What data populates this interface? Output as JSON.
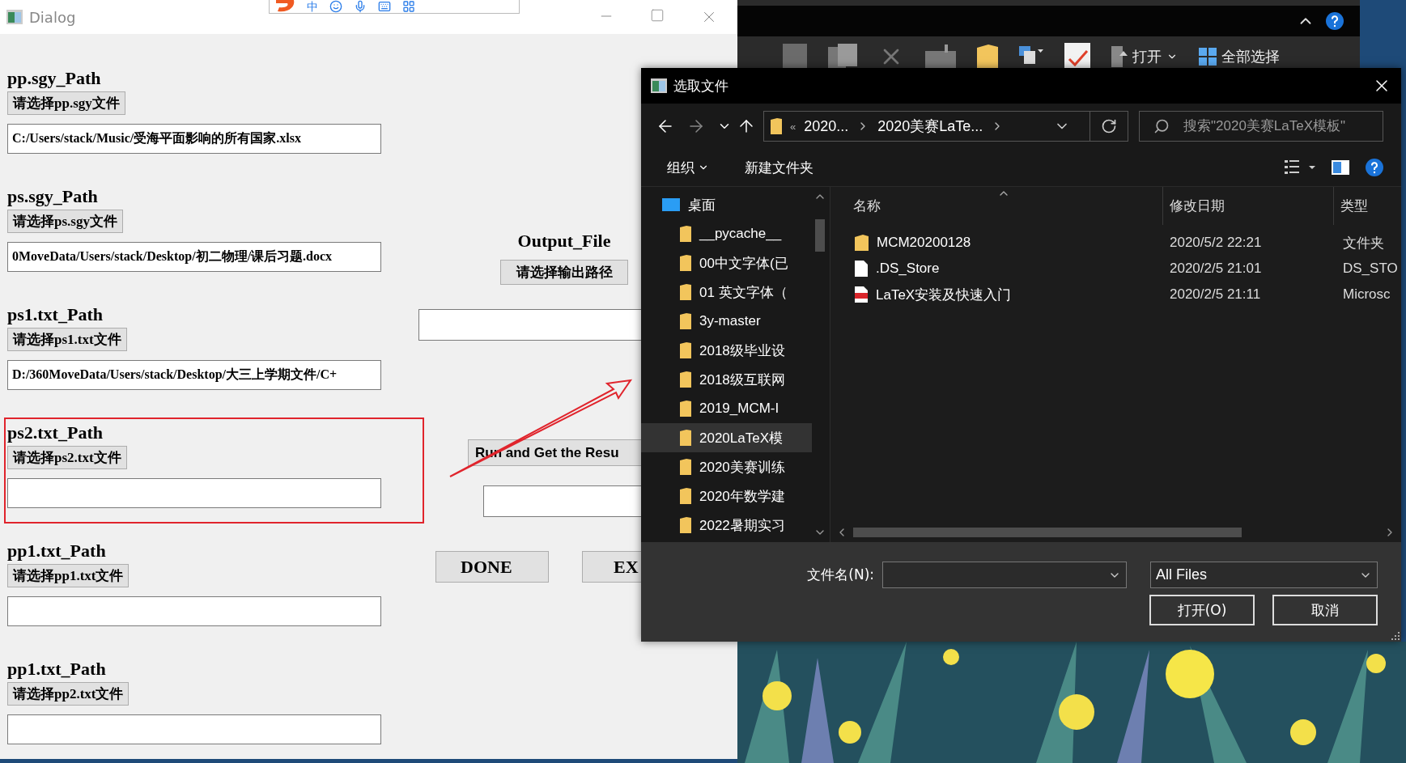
{
  "dialog": {
    "title": "Dialog",
    "ime_mode": "中",
    "sections": [
      {
        "label": "pp.sgy_Path",
        "button": "请选择pp.sgy文件",
        "value": "C:/Users/stack/Music/受海平面影响的所有国家.xlsx",
        "highlighted": false
      },
      {
        "label": "ps.sgy_Path",
        "button": "请选择ps.sgy文件",
        "value": "0MoveData/Users/stack/Desktop/初二物理/课后习题.docx",
        "highlighted": false
      },
      {
        "label": "ps1.txt_Path",
        "button": "请选择ps1.txt文件",
        "value": "D:/360MoveData/Users/stack/Desktop/大三上学期文件/C+",
        "highlighted": false
      },
      {
        "label": "ps2.txt_Path",
        "button": "请选择ps2.txt文件",
        "highlighted": true
      },
      {
        "label": "pp1.txt_Path",
        "button": "请选择pp1.txt文件",
        "highlighted": false
      },
      {
        "label": "pp1.txt_Path",
        "button": "请选择pp2.txt文件",
        "highlighted": false
      }
    ],
    "output": {
      "label": "Output_File",
      "button": "请选择输出路径"
    },
    "run_button": "Run and Get the Resu",
    "done_button": "DONE",
    "exit_button": "EX",
    "arrow": true
  },
  "explorer": {
    "open": "打开",
    "select_all": "全部选择"
  },
  "file_dialog": {
    "title": "选取文件",
    "breadcrumb": [
      "«",
      "2020...",
      "2020美赛LaTe..."
    ],
    "search_placeholder": "搜索\"2020美赛LaTeX模板\"",
    "organize": "组织",
    "new_folder": "新建文件夹",
    "nav": [
      {
        "label": "桌面",
        "kind": "desktop",
        "selected": false,
        "children": [
          {
            "label": "__pycache__",
            "selected": false
          },
          {
            "label": "00中文字体(已",
            "selected": false
          },
          {
            "label": "01 英文字体（",
            "selected": false
          },
          {
            "label": "3y-master",
            "selected": false
          },
          {
            "label": "2018级毕业设",
            "selected": false
          },
          {
            "label": "2018级互联网",
            "selected": false
          },
          {
            "label": "2019_MCM-I",
            "selected": false
          },
          {
            "label": "2020LaTeX模",
            "selected": true
          },
          {
            "label": "2020美赛训练",
            "selected": false
          },
          {
            "label": "2020年数学建",
            "selected": false
          },
          {
            "label": "2022暑期实习",
            "selected": false
          }
        ]
      }
    ],
    "columns": [
      "名称",
      "修改日期",
      "类型"
    ],
    "files": [
      {
        "kind": "folder",
        "name": "MCM20200128",
        "date": "2020/5/2 22:21",
        "type": "文件夹"
      },
      {
        "kind": "file",
        "name": ".DS_Store",
        "date": "2020/2/5 21:01",
        "type": "DS_STO"
      },
      {
        "kind": "pdf",
        "name": "LaTeX安装及快速入门",
        "date": "2020/2/5 21:11",
        "type": "Microsc"
      }
    ],
    "filename_label": "文件名(N):",
    "filter": "All Files",
    "open_button": "打开(O)",
    "cancel_button": "取消"
  }
}
